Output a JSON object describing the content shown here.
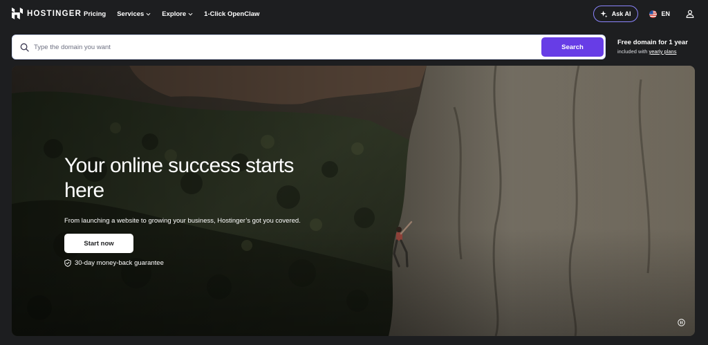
{
  "nav": {
    "logo_text": "HOSTINGER",
    "links": [
      {
        "label": "Pricing",
        "dropdown": false
      },
      {
        "label": "Services",
        "dropdown": true
      },
      {
        "label": "Explore",
        "dropdown": true
      },
      {
        "label": "1-Click OpenClaw",
        "dropdown": false
      }
    ],
    "ask_ai_label": "Ask AI",
    "language_label": "EN",
    "icons": {
      "ask_ai": "sparkle-icon",
      "language": "us-flag-icon",
      "account": "user-icon"
    }
  },
  "search": {
    "placeholder": "Type the domain you want",
    "value": "",
    "button_label": "Search"
  },
  "promo": {
    "title": "Free domain for 1 year",
    "subtitle_prefix": "included with ",
    "link_label": "yearly plans"
  },
  "hero": {
    "title": "Your online success starts here",
    "subtitle": "From launching a website to growing your business, Hostinger’s got you covered.",
    "cta_label": "Start now",
    "guarantee": "30-day money-back guarantee",
    "background": "rock-climber-video"
  },
  "colors": {
    "background": "#1d1e20",
    "accent": "#673de6",
    "ask_ai_border": "#8c85ff",
    "white": "#ffffff"
  }
}
